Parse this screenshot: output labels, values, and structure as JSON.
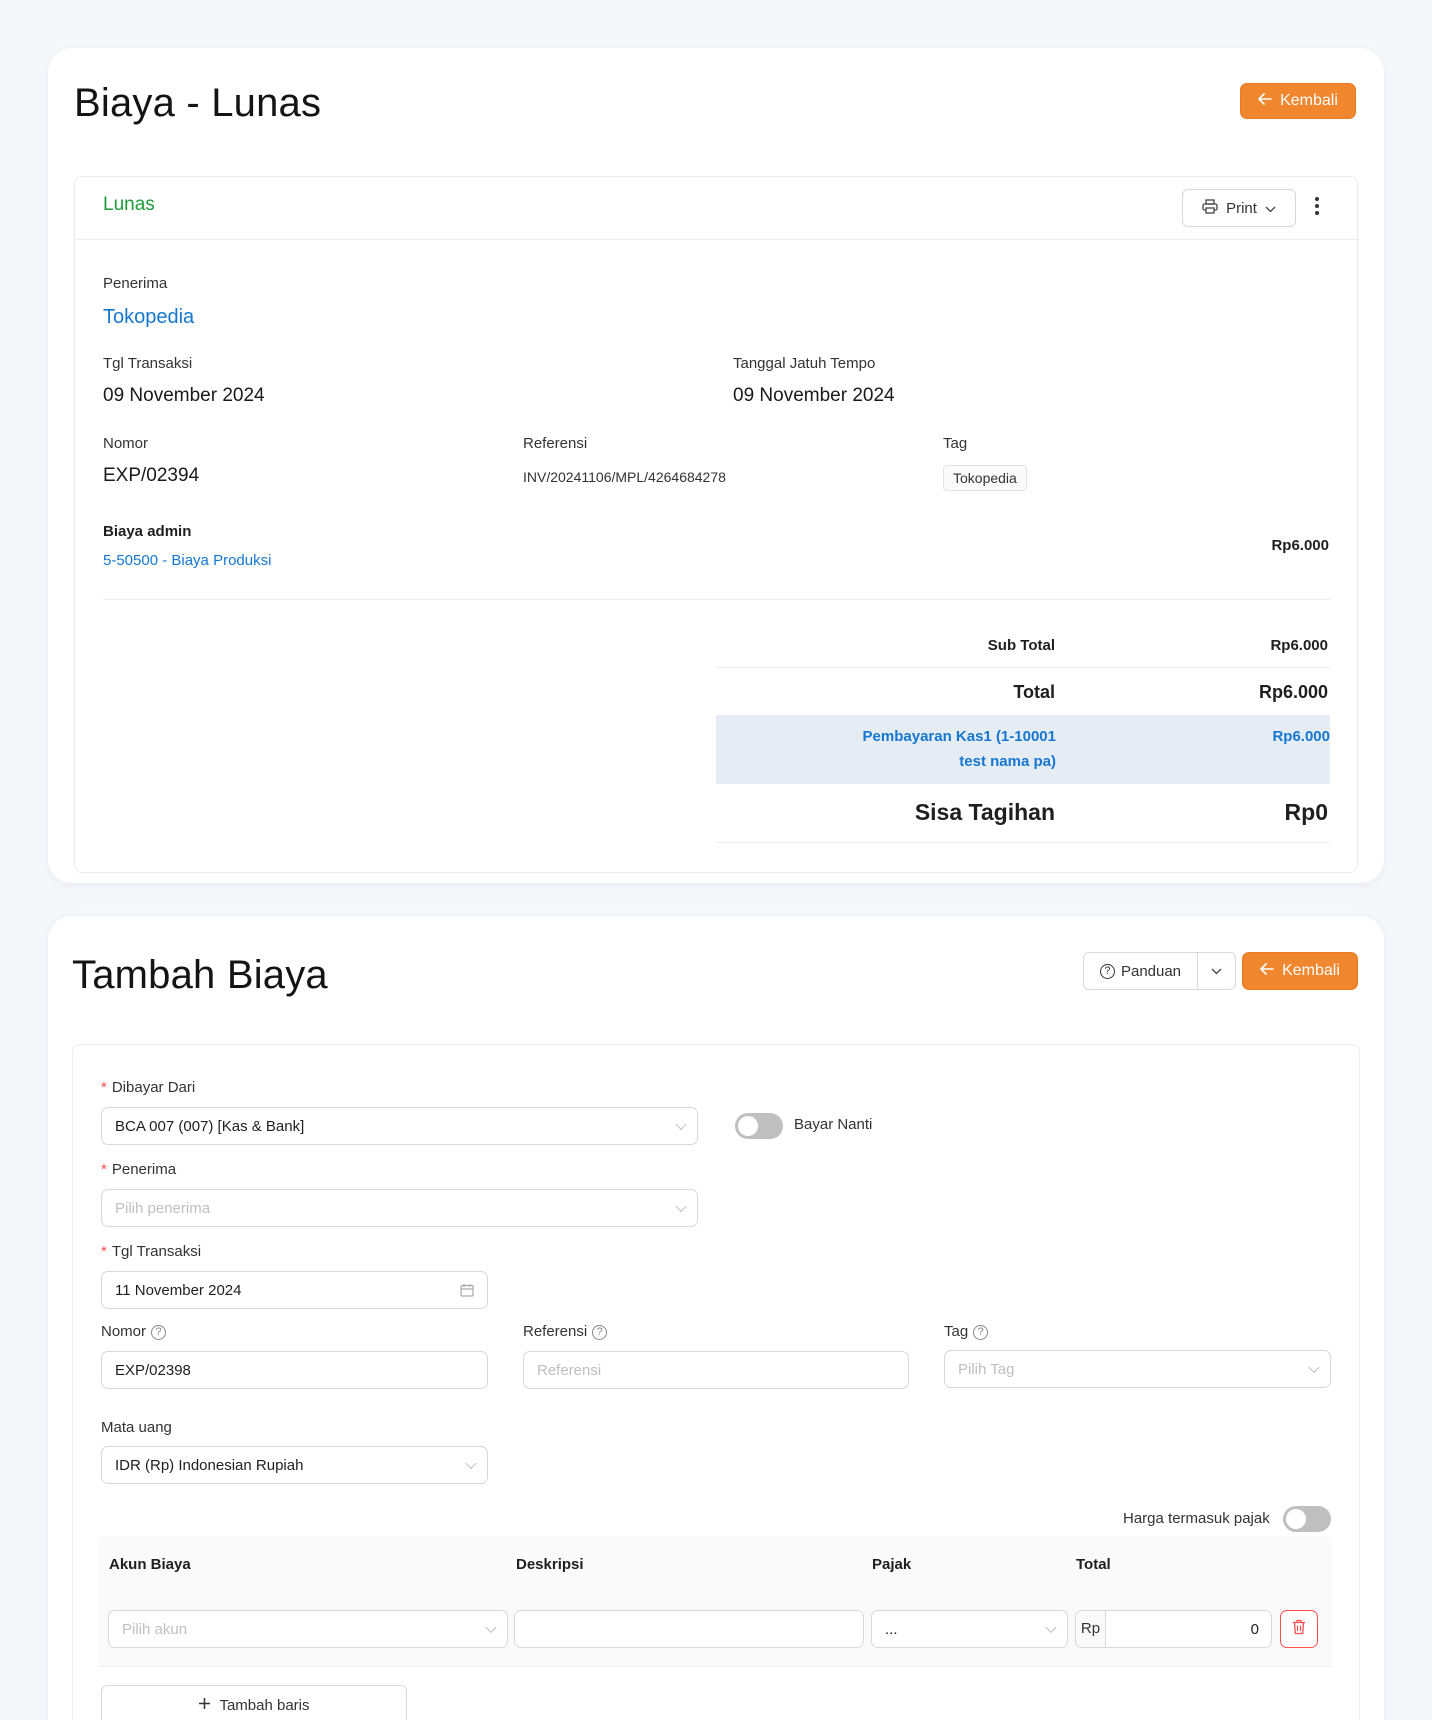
{
  "detail": {
    "title": "Biaya - Lunas",
    "back_label": "Kembali",
    "status": "Lunas",
    "print_label": "Print",
    "recipient_label": "Penerima",
    "recipient": "Tokopedia",
    "trx_date_label": "Tgl Transaksi",
    "trx_date": "09 November 2024",
    "due_date_label": "Tanggal Jatuh Tempo",
    "due_date": "09 November 2024",
    "number_label": "Nomor",
    "number": "EXP/02394",
    "reference_label": "Referensi",
    "reference": "INV/20241106/MPL/4264684278",
    "tag_label": "Tag",
    "tag": "Tokopedia",
    "item_name": "Biaya admin",
    "item_account": "5-50500 - Biaya Produksi",
    "item_amount": "Rp6.000",
    "subtotal_label": "Sub Total",
    "subtotal": "Rp6.000",
    "total_label": "Total",
    "total": "Rp6.000",
    "payment_line1": "Pembayaran Kas1 (1-10001",
    "payment_line2": "test nama pa)",
    "payment_amount": "Rp6.000",
    "balance_label": "Sisa Tagihan",
    "balance": "Rp0"
  },
  "form": {
    "title": "Tambah Biaya",
    "guide_label": "Panduan",
    "back_label": "Kembali",
    "paid_from_label": "Dibayar Dari",
    "paid_from": "BCA 007 (007) [Kas & Bank]",
    "pay_later_label": "Bayar Nanti",
    "recipient_label": "Penerima",
    "recipient_placeholder": "Pilih penerima",
    "trx_date_label": "Tgl Transaksi",
    "trx_date": "11 November 2024",
    "number_label": "Nomor",
    "number": "EXP/02398",
    "reference_label": "Referensi",
    "reference_placeholder": "Referensi",
    "tag_label": "Tag",
    "tag_placeholder": "Pilih Tag",
    "currency_label": "Mata uang",
    "currency": "IDR (Rp) Indonesian Rupiah",
    "tax_inclusive_label": "Harga termasuk pajak",
    "columns": [
      "Akun Biaya",
      "Deskripsi",
      "Pajak",
      "Total"
    ],
    "row": {
      "account_placeholder": "Pilih akun",
      "tax_value": "...",
      "currency_prefix": "Rp",
      "amount": "0"
    },
    "add_row_label": "Tambah baris"
  }
}
